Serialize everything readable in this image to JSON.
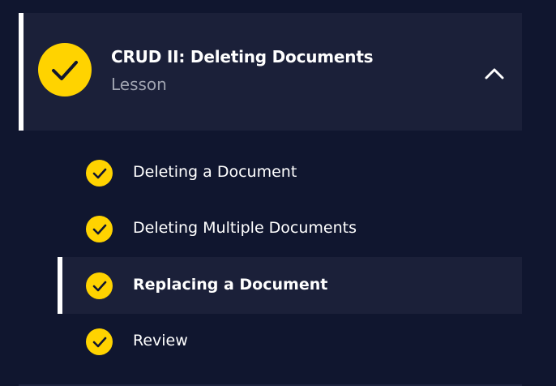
{
  "lesson": {
    "title": "CRUD II: Deleting Documents",
    "subtitle": "Lesson",
    "status_icon": "check-circle-icon",
    "toggle_icon": "chevron-up-icon",
    "expanded": true
  },
  "items": [
    {
      "label": "Deleting a Document",
      "completed": true,
      "active": false
    },
    {
      "label": "Deleting Multiple Documents",
      "completed": true,
      "active": false
    },
    {
      "label": "Replacing a Document",
      "completed": true,
      "active": true
    },
    {
      "label": "Review",
      "completed": true,
      "active": false
    }
  ],
  "colors": {
    "background": "#10162f",
    "panel": "#1b2039",
    "accent": "#ffd300",
    "text": "#ffffff",
    "muted": "#9fa3b0",
    "active_marker": "#ffffff"
  }
}
